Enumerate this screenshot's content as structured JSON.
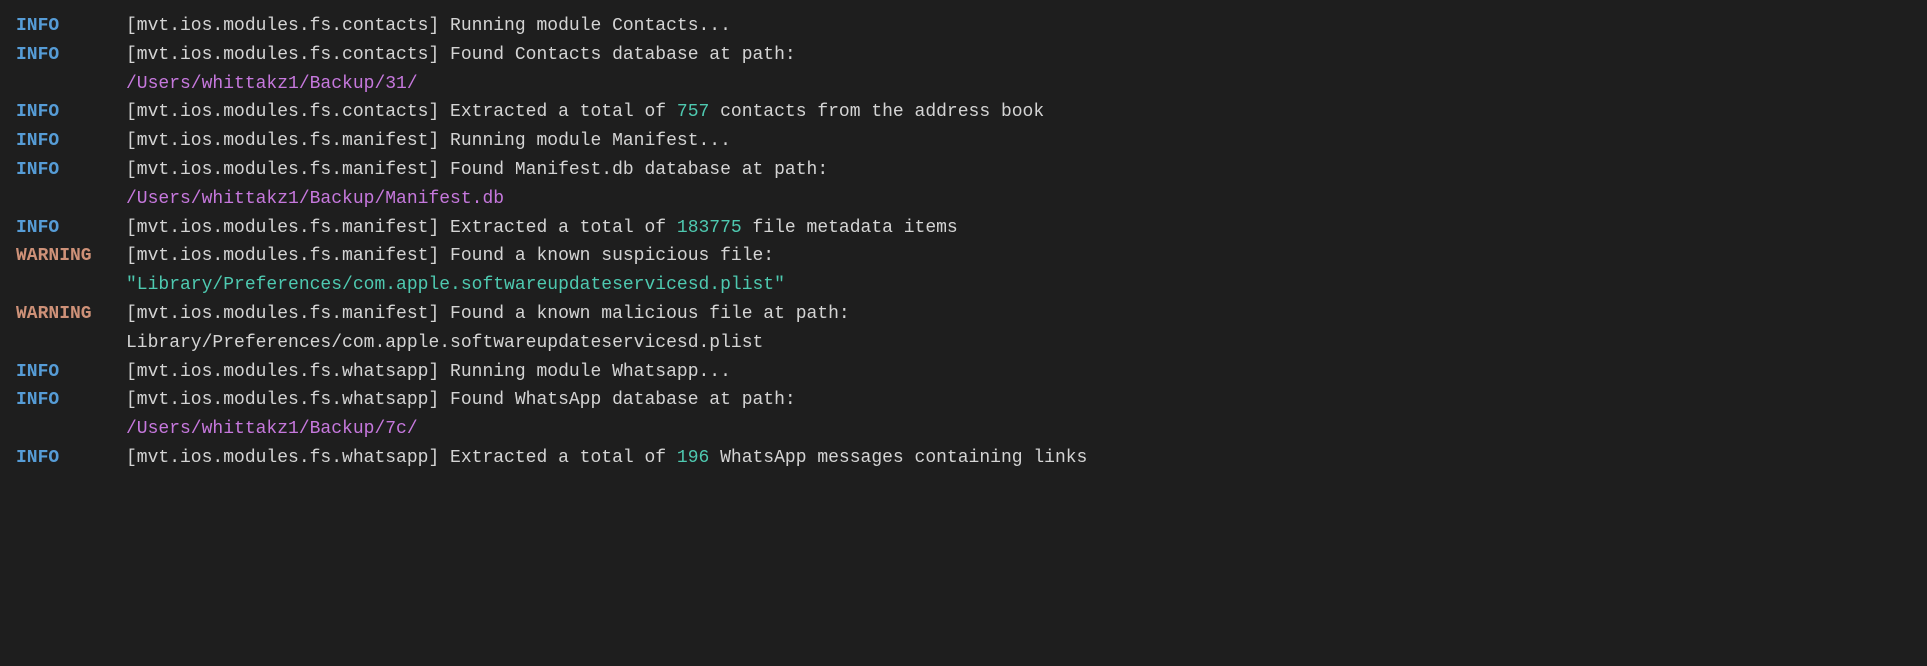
{
  "logs": [
    {
      "level": "INFO",
      "levelClass": "info",
      "parts": [
        {
          "type": "text",
          "content": "[mvt.ios.modules.fs.contacts] Running module Contacts..."
        }
      ]
    },
    {
      "level": "INFO",
      "levelClass": "info",
      "parts": [
        {
          "type": "text",
          "content": "[mvt.ios.modules.fs.contacts] Found Contacts database at path:\n"
        },
        {
          "type": "path",
          "content": "/Users/whittakz1/Backup/31/"
        }
      ]
    },
    {
      "level": "INFO",
      "levelClass": "info",
      "parts": [
        {
          "type": "text",
          "content": "[mvt.ios.modules.fs.contacts] Extracted a total of "
        },
        {
          "type": "number",
          "content": "757"
        },
        {
          "type": "text",
          "content": " contacts from the address book"
        }
      ]
    },
    {
      "level": "INFO",
      "levelClass": "info",
      "parts": [
        {
          "type": "text",
          "content": "[mvt.ios.modules.fs.manifest] Running module Manifest..."
        }
      ]
    },
    {
      "level": "INFO",
      "levelClass": "info",
      "parts": [
        {
          "type": "text",
          "content": "[mvt.ios.modules.fs.manifest] Found Manifest.db database at path:\n"
        },
        {
          "type": "path",
          "content": "/Users/whittakz1/Backup/Manifest.db"
        }
      ]
    },
    {
      "level": "INFO",
      "levelClass": "info",
      "parts": [
        {
          "type": "text",
          "content": "[mvt.ios.modules.fs.manifest] Extracted a total of "
        },
        {
          "type": "number",
          "content": "183775"
        },
        {
          "type": "text",
          "content": " file metadata items"
        }
      ]
    },
    {
      "level": "WARNING",
      "levelClass": "warning",
      "parts": [
        {
          "type": "text",
          "content": "[mvt.ios.modules.fs.manifest] Found a known suspicious file:\n"
        },
        {
          "type": "suspicious",
          "content": "\"Library/Preferences/com.apple.softwareupdateservicesd.plist\""
        }
      ]
    },
    {
      "level": "WARNING",
      "levelClass": "warning",
      "parts": [
        {
          "type": "text",
          "content": "[mvt.ios.modules.fs.manifest] Found a known malicious file at path:\n"
        },
        {
          "type": "malicious",
          "content": "Library/Preferences/com.apple.softwareupdateservicesd.plist"
        }
      ]
    },
    {
      "level": "INFO",
      "levelClass": "info",
      "parts": [
        {
          "type": "text",
          "content": "[mvt.ios.modules.fs.whatsapp] Running module Whatsapp..."
        }
      ]
    },
    {
      "level": "INFO",
      "levelClass": "info",
      "parts": [
        {
          "type": "text",
          "content": "[mvt.ios.modules.fs.whatsapp] Found WhatsApp database at path:\n"
        },
        {
          "type": "path",
          "content": "/Users/whittakz1/Backup/7c/"
        }
      ]
    },
    {
      "level": "INFO",
      "levelClass": "info",
      "parts": [
        {
          "type": "text",
          "content": "[mvt.ios.modules.fs.whatsapp] Extracted a total of "
        },
        {
          "type": "number",
          "content": "196"
        },
        {
          "type": "text",
          "content": " WhatsApp messages containing links"
        }
      ]
    }
  ]
}
